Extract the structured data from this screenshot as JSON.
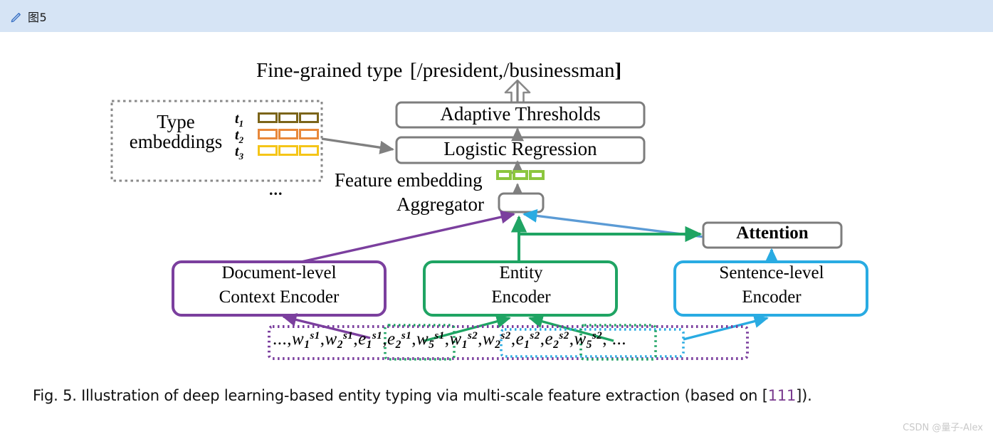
{
  "header": {
    "icon": "pencil-icon",
    "title": "图5"
  },
  "figure": {
    "top": {
      "fine_grained_label": "Fine-grained type",
      "fine_grained_value_open": "[/president,/businessman",
      "fine_grained_value_close": "]"
    },
    "type_embeddings": {
      "label_line1": "Type",
      "label_line2": "embeddings",
      "rows": [
        {
          "symbol": "t",
          "subscript": "1",
          "color": "#7b6419",
          "cells": 3
        },
        {
          "symbol": "t",
          "subscript": "2",
          "color": "#e8883a",
          "cells": 3
        },
        {
          "symbol": "t",
          "subscript": "3",
          "color": "#f5c518",
          "cells": 3
        }
      ],
      "ellipsis": "..."
    },
    "boxes": {
      "adaptive_thresholds": "Adaptive Thresholds",
      "logistic_regression": "Logistic Regression",
      "attention": "Attention",
      "document_encoder_line1": "Document-level",
      "document_encoder_line2": "Context Encoder",
      "entity_encoder_line1": "Entity",
      "entity_encoder_line2": "Encoder",
      "sentence_encoder_line1": "Sentence-level",
      "sentence_encoder_line2": "Encoder"
    },
    "labels": {
      "feature_embedding": "Feature embedding",
      "aggregator": "Aggregator"
    },
    "feature_embedding_strip": {
      "color": "#8cc63e",
      "cells": 3
    },
    "token_sequence": [
      {
        "text": "...,",
        "type": "plain"
      },
      {
        "base": "w",
        "sub": "1",
        "sup": "s1",
        "type": "token"
      },
      {
        "text": ",",
        "type": "plain"
      },
      {
        "base": "w",
        "sub": "2",
        "sup": "s1",
        "type": "token"
      },
      {
        "text": ",",
        "type": "plain"
      },
      {
        "base": "e",
        "sub": "1",
        "sup": "s1",
        "type": "token"
      },
      {
        "text": ",",
        "type": "plain"
      },
      {
        "base": "e",
        "sub": "2",
        "sup": "s1",
        "type": "token"
      },
      {
        "text": ",",
        "type": "plain"
      },
      {
        "base": "w",
        "sub": "5",
        "sup": "s1",
        "type": "token"
      },
      {
        "text": ",",
        "type": "plain"
      },
      {
        "base": "w",
        "sub": "1",
        "sup": "s2",
        "type": "token"
      },
      {
        "text": ",",
        "type": "plain"
      },
      {
        "base": "w",
        "sub": "2",
        "sup": "s2",
        "type": "token"
      },
      {
        "text": ",",
        "type": "plain"
      },
      {
        "base": "e",
        "sub": "1",
        "sup": "s2",
        "type": "token"
      },
      {
        "text": ",",
        "type": "plain"
      },
      {
        "base": "e",
        "sub": "2",
        "sup": "s2",
        "type": "token"
      },
      {
        "text": ",",
        "type": "plain"
      },
      {
        "base": "w",
        "sub": "5",
        "sup": "s2",
        "type": "token"
      },
      {
        "text": ", ...",
        "type": "plain"
      }
    ],
    "colors": {
      "purple": "#7b3f9e",
      "green": "#1fa463",
      "blue": "#29abe2",
      "gray": "#808080",
      "light_green": "#8cc63e"
    }
  },
  "caption": {
    "prefix": "Fig. 5.  Illustration of deep learning-based entity typing via multi-scale feature extraction (based on [",
    "reference": "111",
    "suffix": "]).",
    "reference_color": "#7a3b8f"
  },
  "watermark": "CSDN @量子-Alex"
}
